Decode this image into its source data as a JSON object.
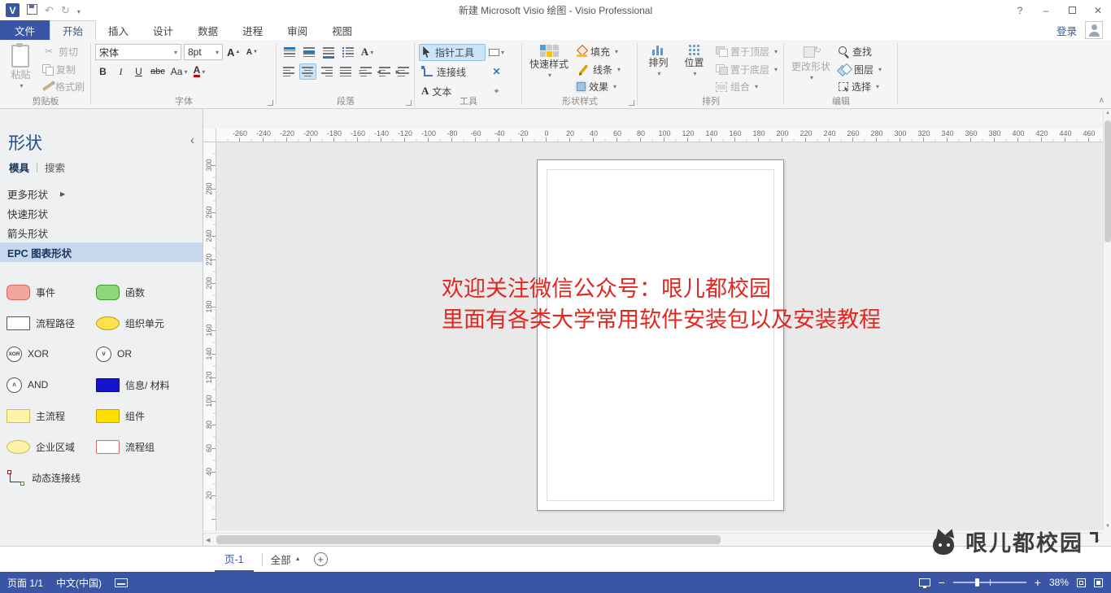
{
  "window": {
    "title": "新建 Microsoft Visio 绘图 - Visio Professional",
    "help": "?",
    "signin": "登录"
  },
  "tabs": [
    {
      "id": "file",
      "label": "文件",
      "type": "file"
    },
    {
      "id": "home",
      "label": "开始",
      "active": true
    },
    {
      "id": "insert",
      "label": "插入"
    },
    {
      "id": "design",
      "label": "设计"
    },
    {
      "id": "data",
      "label": "数据"
    },
    {
      "id": "process",
      "label": "进程"
    },
    {
      "id": "review",
      "label": "审阅"
    },
    {
      "id": "view",
      "label": "视图"
    }
  ],
  "ribbon": {
    "clipboard": {
      "label": "剪贴板",
      "paste": "粘贴",
      "cut": "剪切",
      "copy": "复制",
      "painter": "格式刷"
    },
    "font": {
      "label": "字体",
      "name": "宋体",
      "size": "8pt",
      "bold": "B",
      "italic": "I",
      "underline": "U",
      "strike": "abc",
      "case": "Aa",
      "color": "A",
      "grow": "A",
      "shrink": "A"
    },
    "paragraph": {
      "label": "段落"
    },
    "tools": {
      "label": "工具",
      "pointer": "指针工具",
      "connector": "连接线",
      "text": "文本"
    },
    "shape_styles": {
      "label": "形状样式",
      "quick": "快速样式",
      "fill": "填充",
      "line": "线条",
      "effects": "效果"
    },
    "arrange": {
      "label": "排列",
      "align": "排列",
      "position": "位置",
      "front": "置于顶层",
      "back": "置于底层",
      "group": "组合"
    },
    "editing": {
      "label": "编辑",
      "change": "更改形状",
      "find": "查找",
      "layers": "图层",
      "select": "选择"
    }
  },
  "shapes_panel": {
    "title": "形状",
    "tab_stencils": "模具",
    "tab_search": "搜索",
    "sections": [
      {
        "id": "more-shapes",
        "label": "更多形状",
        "arrow": true
      },
      {
        "id": "quick-shapes",
        "label": "快速形状"
      },
      {
        "id": "arrow-shapes",
        "label": "箭头形状"
      },
      {
        "id": "epc-shapes",
        "label": "EPC 图表形状",
        "active": true
      }
    ],
    "stencil_items": [
      {
        "id": "event",
        "label": "事件",
        "shape": "rounded",
        "fill": "#f2a6a2",
        "stroke": "#d96a60"
      },
      {
        "id": "function",
        "label": "函数",
        "shape": "rounded",
        "fill": "#8ed87c",
        "stroke": "#3f9e33"
      },
      {
        "id": "process-path",
        "label": "流程路径",
        "shape": "rect",
        "fill": "#ffffff",
        "stroke": "#555555"
      },
      {
        "id": "org-unit",
        "label": "组织单元",
        "shape": "ellipse",
        "fill": "#ffe14d",
        "stroke": "#bfa000"
      },
      {
        "id": "xor",
        "label": "XOR",
        "shape": "circle",
        "text": "XOR"
      },
      {
        "id": "or",
        "label": "OR",
        "shape": "circle",
        "text": "V"
      },
      {
        "id": "and",
        "label": "AND",
        "shape": "circle",
        "text": "Λ"
      },
      {
        "id": "info-material",
        "label": "信息/ 材料",
        "shape": "rect",
        "fill": "#1414cf",
        "stroke": "#0a0a8f"
      },
      {
        "id": "main-process",
        "label": "主流程",
        "shape": "rect",
        "fill": "#fdf3a9",
        "stroke": "#cfc04a"
      },
      {
        "id": "component",
        "label": "组件",
        "shape": "rect",
        "fill": "#ffdf00",
        "stroke": "#bfa700"
      },
      {
        "id": "enterprise-area",
        "label": "企业区域",
        "shape": "ellipse",
        "fill": "#fdf3a9",
        "stroke": "#cfc04a"
      },
      {
        "id": "process-group",
        "label": "流程组",
        "shape": "flag",
        "fill": "#ffffff",
        "stroke": "#d96a60"
      },
      {
        "id": "dynamic-connector",
        "label": "动态连接线",
        "shape": "connector"
      }
    ]
  },
  "canvas": {
    "ruler_h": [
      -260,
      -240,
      -220,
      -200,
      -180,
      -160,
      -140,
      -120,
      -100,
      -80,
      -60,
      -40,
      -20,
      0,
      20,
      40,
      60,
      80,
      100,
      120,
      140,
      160,
      180,
      200,
      220,
      240,
      260,
      280,
      300,
      320,
      340,
      360,
      380,
      400,
      420,
      440,
      460
    ],
    "ruler_v": [
      300,
      280,
      260,
      240,
      220,
      200,
      180,
      160,
      140,
      120,
      100,
      80,
      60,
      40,
      20
    ],
    "page_lines": [
      "欢迎关注微信公众号：哏儿都校园",
      "里面有各类大学常用软件安装包以及安装教程"
    ],
    "text_color": "#e3261f"
  },
  "pagebar": {
    "page": "页-1",
    "all": "全部"
  },
  "watermark": {
    "text": "哏儿都校园"
  },
  "statusbar": {
    "page": "页面 1/1",
    "lang": "中文(中国)",
    "zoom": "38%"
  },
  "colors": {
    "accent": "#3955a3",
    "selection": "#c6d7ee"
  }
}
